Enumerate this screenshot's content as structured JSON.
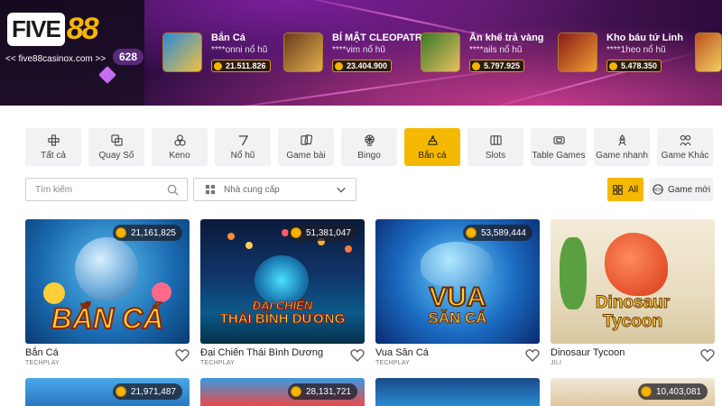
{
  "header": {
    "logo_left": "FIVE",
    "logo_right": "88",
    "site_url": "<< five88casinox.com >>",
    "counter": "628"
  },
  "jackpots": [
    {
      "name": "Bắn Cá",
      "user": "****onni nổ hũ",
      "amount": "21.511.826"
    },
    {
      "name": "BÍ MẬT CLEOPATRA",
      "user": "****vim nổ hũ",
      "amount": "23.404.900"
    },
    {
      "name": "Ăn khế trả vàng",
      "user": "****ails nổ hũ",
      "amount": "5.797.925"
    },
    {
      "name": "Kho báu tứ Linh",
      "user": "****1heo nổ hũ",
      "amount": "5.478.350"
    }
  ],
  "categories": [
    {
      "label": "Tất cả",
      "icon": "all-games-icon"
    },
    {
      "label": "Quay Số",
      "icon": "dice-icon"
    },
    {
      "label": "Keno",
      "icon": "keno-balls-icon"
    },
    {
      "label": "Nổ hũ",
      "icon": "slot-seven-icon"
    },
    {
      "label": "Game bài",
      "icon": "cards-icon"
    },
    {
      "label": "Bingo",
      "icon": "bingo-wheel-icon"
    },
    {
      "label": "Bắn cá",
      "icon": "fish-shooter-icon",
      "active": true
    },
    {
      "label": "Slots",
      "icon": "slot-machine-icon"
    },
    {
      "label": "Table Games",
      "icon": "table-icon"
    },
    {
      "label": "Game nhanh",
      "icon": "rocket-icon"
    },
    {
      "label": "Game Khác",
      "icon": "more-games-icon"
    }
  ],
  "filters": {
    "search_placeholder": "Tìm kiếm",
    "provider_placeholder": "Nhà cung cấp",
    "all_label": "All",
    "new_label": "Game mới"
  },
  "games": [
    {
      "title": "Bắn Cá",
      "provider": "TECHPLAY",
      "jackpot": "21,161,825",
      "art": "BẮN CÁ"
    },
    {
      "title": "Đại Chiến Thái Bình Dương",
      "provider": "TECHPLAY",
      "jackpot": "51,381,047",
      "art_top": "ĐẠI CHIẾN",
      "art_bottom": "THÁI BÌNH DƯƠNG"
    },
    {
      "title": "Vua Săn Cá",
      "provider": "TECHPLAY",
      "jackpot": "53,589,444",
      "art_top": "VUA",
      "art_bottom": "SĂN CÁ"
    },
    {
      "title": "Dinosaur Tycoon",
      "provider": "JILI",
      "jackpot": "",
      "art_top": "Dinosaur",
      "art_bottom": "Tycoon"
    }
  ],
  "games_row2": [
    {
      "jackpot": "21,971,487"
    },
    {
      "jackpot": "28,131,721"
    },
    {
      "jackpot": ""
    },
    {
      "jackpot": "10,403,081"
    }
  ],
  "colors": {
    "accent": "#f5b800",
    "tab_bg": "#f2f2f4"
  }
}
